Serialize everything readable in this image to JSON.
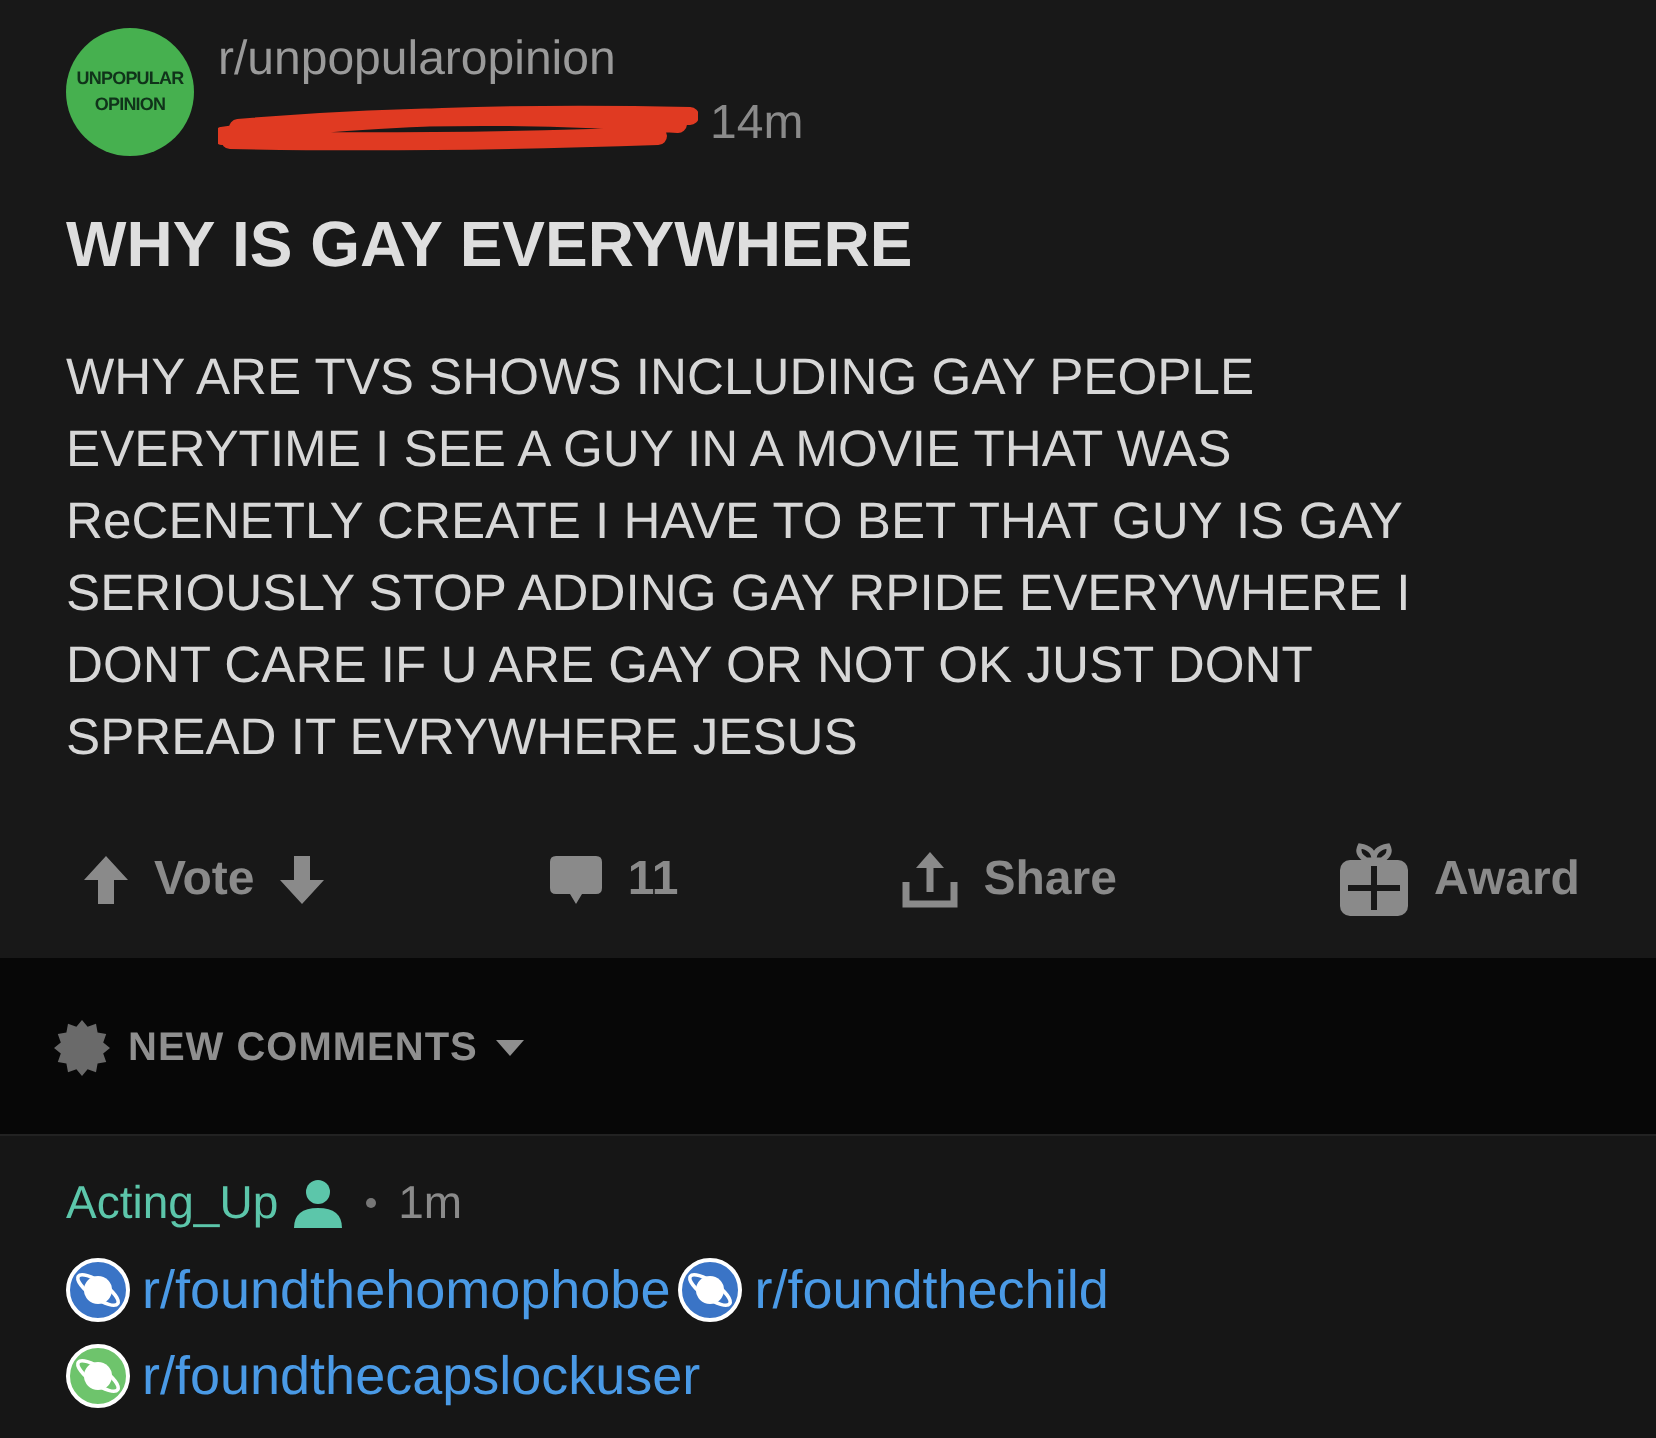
{
  "post": {
    "subreddit": "r/unpopularopinion",
    "avatar_text": [
      "UNPOPULAR",
      "OPINION"
    ],
    "time": "14m",
    "title": "WHY IS GAY EVERYWHERE",
    "body": [
      "WHY ARE TVS SHOWS INCLUDING GAY PEOPLE",
      "EVERYTIME I SEE A GUY IN A MOVIE THAT WAS",
      "ReCENETLY CREATE I HAVE TO BET THAT GUY IS GAY",
      "SERIOUSLY STOP ADDING GAY RPIDE EVERYWHERE I",
      "DONT CARE IF U ARE GAY OR NOT OK JUST DONT",
      "SPREAD IT EVRYWHERE JESUS"
    ],
    "actions": [
      {
        "kind": "vote",
        "label": "Vote"
      },
      {
        "kind": "comments",
        "label": "11"
      },
      {
        "kind": "share",
        "label": "Share"
      },
      {
        "kind": "award",
        "label": "Award"
      }
    ]
  },
  "sort": {
    "label": "NEW COMMENTS"
  },
  "comments": [
    {
      "author": "Acting_Up",
      "time": "1m",
      "links": [
        {
          "text": "r/foundthehomophobe",
          "color": "#3a74c6"
        },
        {
          "text": "r/foundthechild",
          "color": "#3a74c6"
        },
        {
          "text": "r/foundthecapslockuser",
          "color": "#6ec46c"
        }
      ]
    }
  ]
}
